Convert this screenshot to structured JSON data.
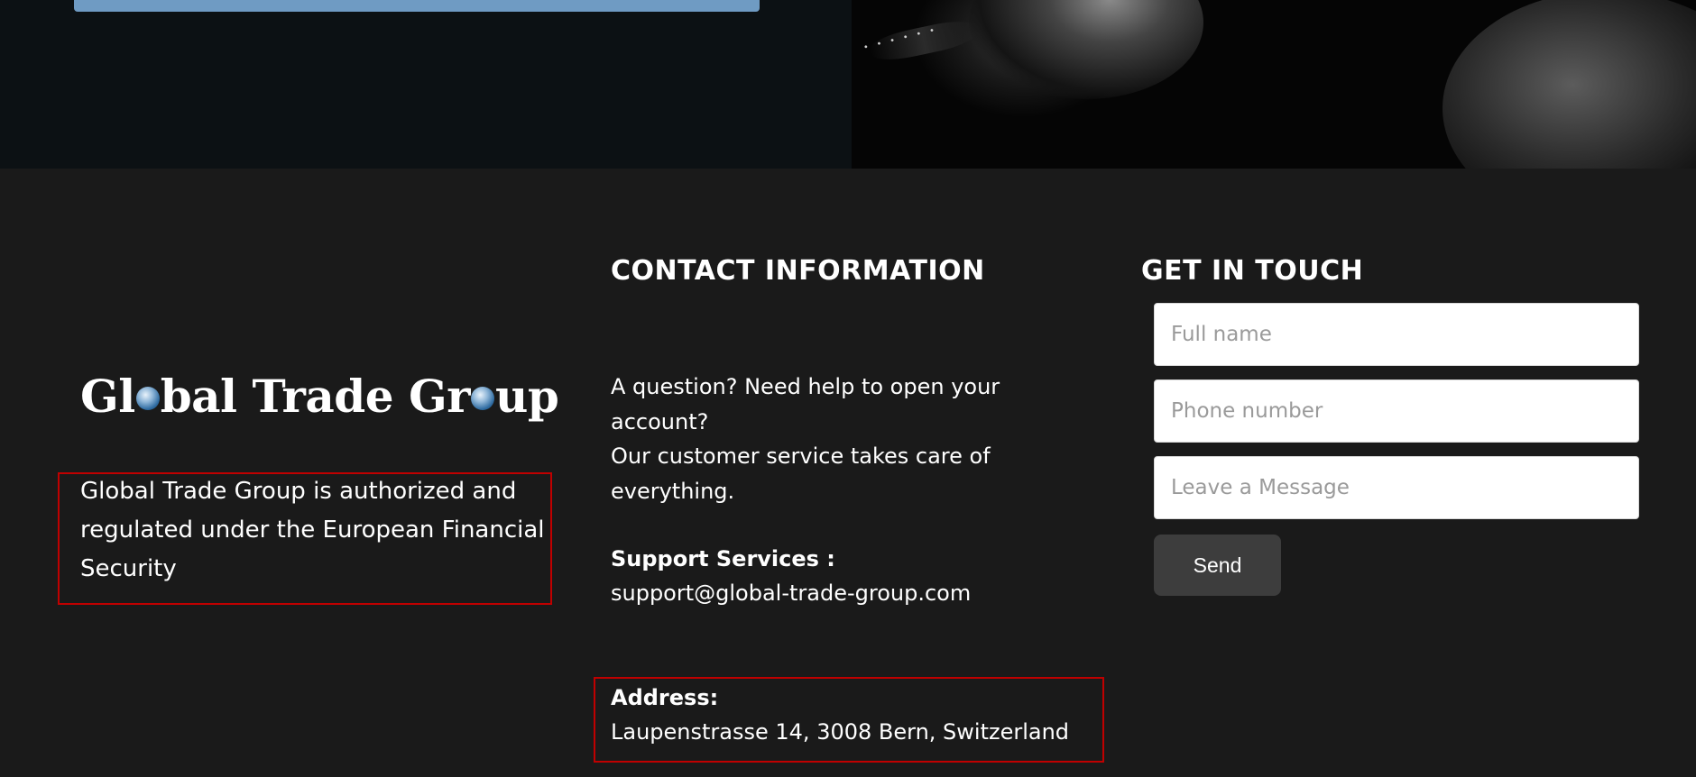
{
  "footer": {
    "logo_text": {
      "part1": "Gl",
      "part2": "bal Trade Gr",
      "part3": "up"
    },
    "about_text": "Global Trade Group is authorized and regulated under the European Financial Security",
    "contact": {
      "title": "CONTACT INFORMATION",
      "intro_line1": "A question? Need help to open your account?",
      "intro_line2": "Our customer service takes care of everything.",
      "support_label": "Support Services :",
      "support_email": "support@global-trade-group.com",
      "address_label": "Address:",
      "address_value": "Laupenstrasse 14, 3008 Bern, Switzerland"
    },
    "form": {
      "title": "GET IN TOUCH",
      "fullname_placeholder": "Full name",
      "phone_placeholder": "Phone number",
      "message_placeholder": "Leave a Message",
      "send_label": "Send"
    }
  },
  "colors": {
    "footer_bg": "#1a1a1a",
    "hero_bar": "#6f9bc3",
    "highlight_border": "#c00000",
    "button_bg": "#3d3d3d"
  }
}
